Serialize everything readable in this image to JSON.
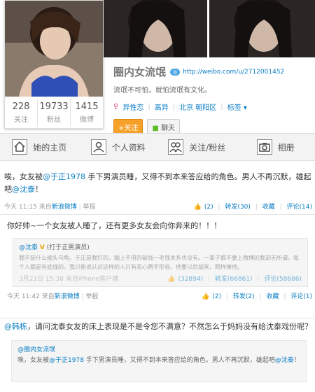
{
  "profile": {
    "name": "圈内女流氓",
    "level_badge": "◎",
    "url": "http://weibo.com/u/2712001452",
    "bio": "流氓不可怕，就怕流氓有文化。",
    "gender": "♀",
    "gender_label": "异性恋",
    "sign": "高异",
    "location": "北京 朝阳区",
    "tag": "标签 ▾",
    "follow_button": "+关注",
    "chat_button": "聊天",
    "stats": [
      {
        "value": "228",
        "label": "关注"
      },
      {
        "value": "19733",
        "label": "粉丝"
      },
      {
        "value": "1415",
        "label": "微博"
      }
    ]
  },
  "tabs": [
    {
      "label": "她的主页",
      "icon": "home-icon"
    },
    {
      "label": "个人资料",
      "icon": "person-icon"
    },
    {
      "label": "关注/粉丝",
      "icon": "people-icon"
    },
    {
      "label": "相册",
      "icon": "camera-icon"
    }
  ],
  "post1": {
    "text_a": "唉，女友被",
    "mention1": "@于正1978",
    "text_b": " 手下男演员睡，又得不到本来答应给的角色。男人不再沉默，雄起吧",
    "mention2": "@沈泰",
    "text_c": "！",
    "time": "今天 11:15",
    "source_prefix": "来自",
    "source": "新浪微博",
    "report": "举报",
    "like": "(2)",
    "repost": "转发(30)",
    "favorite": "收藏",
    "comment": "评论(14)"
  },
  "post2": {
    "text": "你好帅~一个女友被人睡了，还有更多女友会向你奔来的！！！",
    "forward_name": "@沈泰",
    "forward_badge": "V",
    "forward_note": "(打于正男演员)",
    "forward_text": "我不装什么缩头乌龟。于正是我打的，踹上不但的破线一毛钱关系也没有。一辈子都不要上微博的我却无所谓。每个人都是有底线的。我只能说认识这样的人只有恶心两字形容。他要以后胡来，照样揍他。",
    "forward_time": "3月21日 15:38",
    "forward_source": "来自iPhone客户端",
    "forward_like": "(32894)",
    "forward_repost": "转发(66861)",
    "forward_comment": "评论(58686)",
    "time": "今天 11:42",
    "source_prefix": "来自",
    "source": "新浪微博",
    "report": "举报",
    "like": "(2)",
    "repost": "转发(2)",
    "favorite": "收藏",
    "comment": "评论(1)"
  },
  "post3": {
    "mention": "@韩栋",
    "text": "，请问沈泰女友的床上表现是不是令您不满意？不然怎么于妈妈没有给沈泰戏份呢？",
    "forward_name": "@圈内女流氓",
    "forward_text_a": "唉，女友被",
    "forward_mention": "@于正1978",
    "forward_text_b": " 手下男演员睡，又得不到本来答应给的角色。男人不再沉默，雄起吧",
    "forward_mention2": "@沈泰",
    "forward_text_c": "！"
  }
}
